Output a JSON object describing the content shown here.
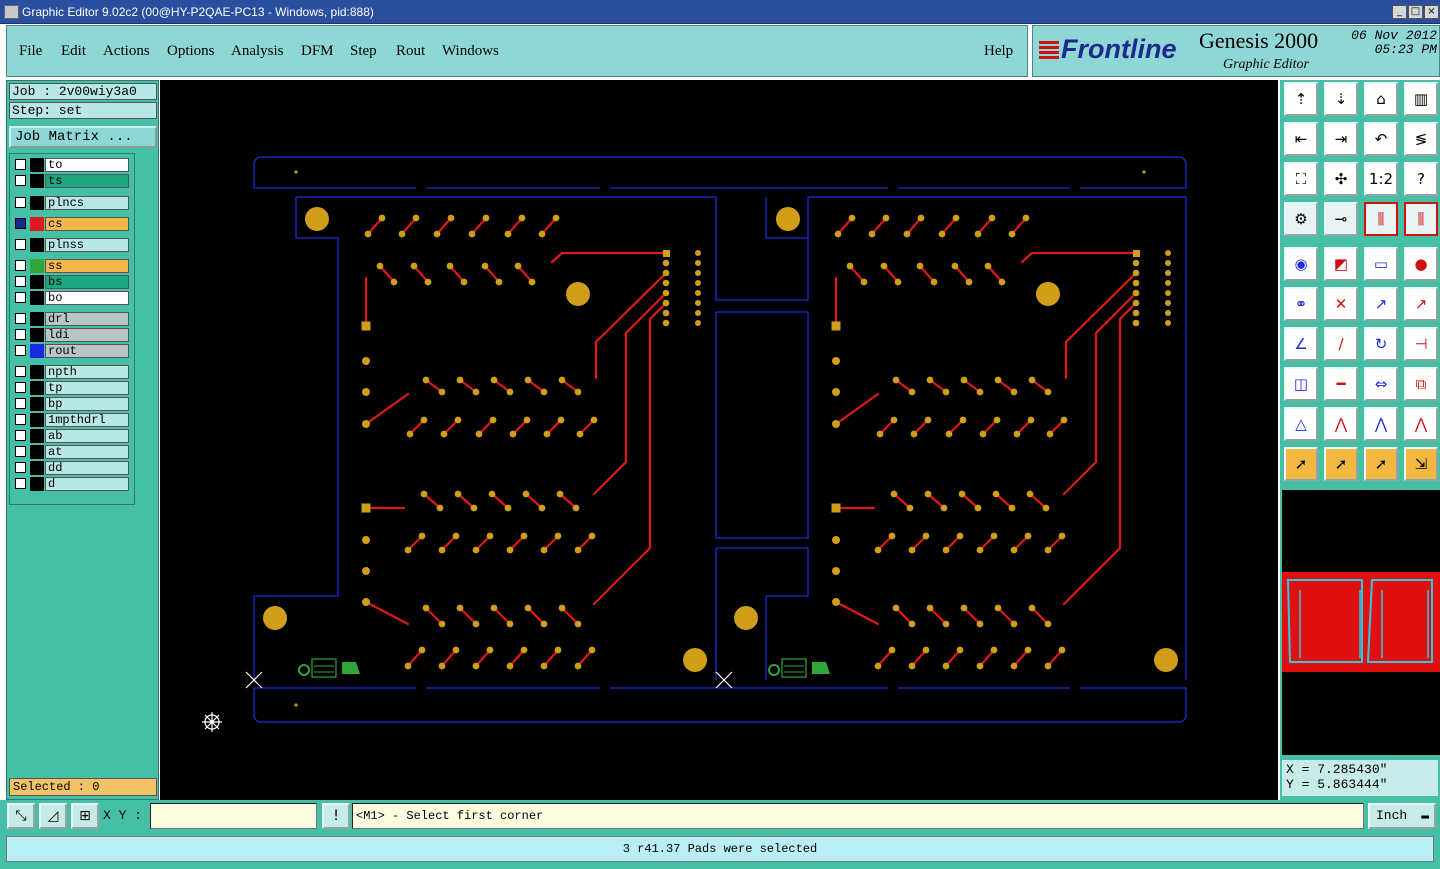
{
  "window": {
    "title": "Graphic Editor 9.02c2 (00@HY-P2QAE-PC13 - Windows, pid:888)",
    "controls": [
      "_",
      "□",
      "×"
    ]
  },
  "menu": {
    "items": [
      "File",
      "Edit",
      "Actions",
      "Options",
      "Analysis",
      "DFM",
      "Step",
      "Rout",
      "Windows"
    ],
    "help": "Help"
  },
  "brand": {
    "logo": "Frontline",
    "product": "Genesis 2000",
    "subtitle": "Graphic Editor",
    "date": "06 Nov 2012",
    "time": "05:23 PM"
  },
  "job": {
    "job_line": "Job : 2v00wiy3a0",
    "step_line": "Step: set",
    "matrix_button": "Job Matrix ..."
  },
  "layers": [
    {
      "name": "to",
      "color": "#ffffff",
      "swatch": "#000000",
      "checked": false
    },
    {
      "name": "ts",
      "color": "#1ea67f",
      "swatch": "#000000",
      "checked": false
    },
    {
      "name": "plncs",
      "color": "#b9e7e5",
      "swatch": "#000000",
      "checked": false
    },
    {
      "name": "cs",
      "color": "#f3b64a",
      "swatch": "#e01818",
      "checked": true
    },
    {
      "name": "plnss",
      "color": "#b9e7e5",
      "swatch": "#000000",
      "checked": false
    },
    {
      "name": "ss",
      "color": "#f3b64a",
      "swatch": "#2fa53a",
      "checked": false
    },
    {
      "name": "bs",
      "color": "#1ea67f",
      "swatch": "#000000",
      "checked": false
    },
    {
      "name": "bo",
      "color": "#ffffff",
      "swatch": "#000000",
      "checked": false
    },
    {
      "name": "drl",
      "color": "#b8c6c6",
      "swatch": "#000000",
      "checked": false
    },
    {
      "name": "ldi",
      "color": "#b8c6c6",
      "swatch": "#000000",
      "checked": false
    },
    {
      "name": "rout",
      "color": "#b8c6c6",
      "swatch": "#1a2ae0",
      "checked": false
    },
    {
      "name": "npth",
      "color": "#b9e7e5",
      "swatch": "#000000",
      "checked": false
    },
    {
      "name": "tp",
      "color": "#b9e7e5",
      "swatch": "#000000",
      "checked": false
    },
    {
      "name": "bp",
      "color": "#b9e7e5",
      "swatch": "#000000",
      "checked": false
    },
    {
      "name": "1mpthdrl",
      "color": "#b9e7e5",
      "swatch": "#000000",
      "checked": false
    },
    {
      "name": "ab",
      "color": "#b9e7e5",
      "swatch": "#000000",
      "checked": false
    },
    {
      "name": "at",
      "color": "#b9e7e5",
      "swatch": "#000000",
      "checked": false
    },
    {
      "name": "dd",
      "color": "#b9e7e5",
      "swatch": "#000000",
      "checked": false
    },
    {
      "name": "d",
      "color": "#b9e7e5",
      "swatch": "#000000",
      "checked": false
    }
  ],
  "selected": "Selected : 0",
  "canvas_colors": {
    "background": "#000000",
    "outline": "#1c2ad8",
    "pad": "#cf9f1a",
    "trace": "#e01818",
    "silk": "#2fa53a",
    "marker": "#ffffff"
  },
  "toolbar": {
    "row1": [
      "zoom-home-icon",
      "zoom-down-icon",
      "home-icon",
      "panel-icon"
    ],
    "row2": [
      "pan-left-icon",
      "pan-right-icon",
      "undo-view-icon",
      "redraw-icon"
    ],
    "row3": [
      "fit-icon",
      "center-icon",
      "one-to-one-icon",
      "help-icon"
    ],
    "row4": [
      "snap-icon",
      "measure-point-icon",
      "layers-red-icon",
      "layers-red2-icon"
    ],
    "one_to_one": "1:2",
    "help": "?"
  },
  "coords": {
    "x": "X = 7.285430\"",
    "y": "Y = 5.863444\""
  },
  "bottom": {
    "xy_label": "X Y :",
    "xy_value": "",
    "alert": "!",
    "prompt": "<M1> - Select first corner",
    "unit": "Inch"
  },
  "status": "3 r41.37 Pads were selected"
}
